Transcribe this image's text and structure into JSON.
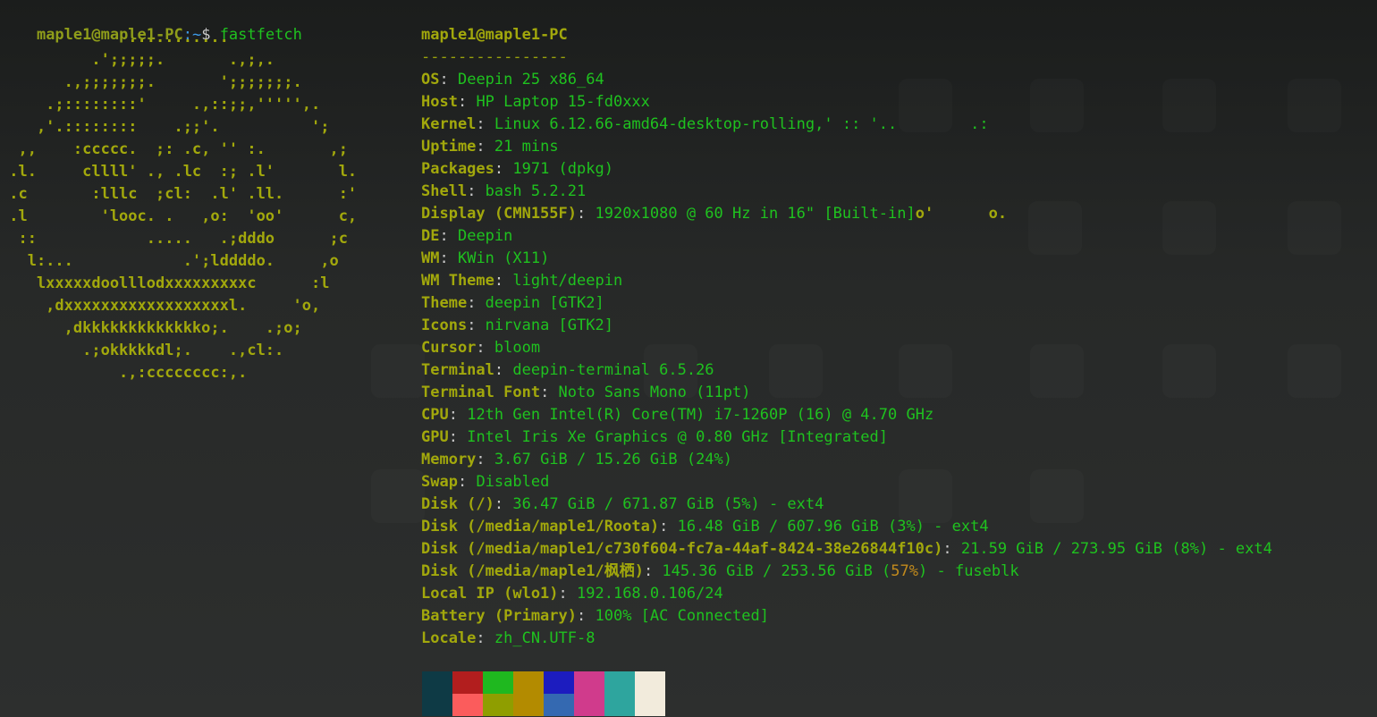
{
  "prompt": {
    "user_host": "maple1@maple1-PC",
    "path": ":~",
    "symbol": "$",
    "command": " fastfetch"
  },
  "logo_lines": [
    "              ...........",
    "          .';;;;;.       .,;,.",
    "       .,;;;;;;;.       ';;;;;;;.",
    "     .;::::::::'     .,::;;,''''',.",
    "    ,'.::::::::    .;;'.          ';",
    "  ,,    :ccccc.  ;: .c, '' :.       ,;",
    " .l.     cllll' ., .lc  :; .l'       l.",
    " .c       :lllc  ;cl:  .l' .ll.      :'",
    " .l        'looc. .   ,o:  'oo'      c,",
    "  ::            .....   .;dddo      ;c",
    "   l:...            .';lddddo.     ,o",
    "    lxxxxxdoolllodxxxxxxxxxc      :l",
    "     ,dxxxxxxxxxxxxxxxxxxl.     'o,",
    "       ,dkkkkkkkkkkkkko;.    .;o;",
    "         .;okkkkkdl;.    .,cl:.",
    "             .,:cccccccc:,."
  ],
  "info": {
    "title": "maple1@maple1-PC",
    "separator": "----------------",
    "rows": [
      {
        "key": "OS",
        "value": "Deepin 25 x86_64"
      },
      {
        "key": "Host",
        "value": "HP Laptop 15-fd0xxx"
      },
      {
        "key": "Kernel",
        "value": "Linux 6.12.66-amd64-desktop-rolling,' :: '..        .:"
      },
      {
        "key": "Uptime",
        "value": "21 mins"
      },
      {
        "key": "Packages",
        "value": "1971 (dpkg)"
      },
      {
        "key": "Shell",
        "value": "bash 5.2.21"
      },
      {
        "key": "Display (CMN155F)",
        "value": "1920x1080 @ 60 Hz in 16\" [Built-in]",
        "tail": "o'      o."
      },
      {
        "key": "DE",
        "value": "Deepin"
      },
      {
        "key": "WM",
        "value": "KWin (X11)"
      },
      {
        "key": "WM Theme",
        "value": "light/deepin"
      },
      {
        "key": "Theme",
        "value": "deepin [GTK2]"
      },
      {
        "key": "Icons",
        "value": "nirvana [GTK2]"
      },
      {
        "key": "Cursor",
        "value": "bloom"
      },
      {
        "key": "Terminal",
        "value": "deepin-terminal 6.5.26"
      },
      {
        "key": "Terminal Font",
        "value": "Noto Sans Mono (11pt)"
      },
      {
        "key": "CPU",
        "value": "12th Gen Intel(R) Core(TM) i7-1260P (16) @ 4.70 GHz"
      },
      {
        "key": "GPU",
        "value": "Intel Iris Xe Graphics @ 0.80 GHz [Integrated]"
      },
      {
        "key": "Memory",
        "value": "3.67 GiB / 15.26 GiB (24%)"
      },
      {
        "key": "Swap",
        "value": "Disabled"
      },
      {
        "key": "Disk (/)",
        "value": "36.47 GiB / 671.87 GiB (5%) - ext4"
      },
      {
        "key": "Disk (/media/maple1/Roota)",
        "value": "16.48 GiB / 607.96 GiB (3%) - ext4"
      },
      {
        "key": "Disk (/media/maple1/c730f604-fc7a-44af-8424-38e26844f10c)",
        "value": "21.59 GiB / 273.95 GiB (8%) - ext4"
      },
      {
        "key": "Disk (/media/maple1/枫栖)",
        "value_pre": "145.36 GiB / 253.56 GiB (",
        "value_warn": "57%",
        "value_post": ") - fuseblk"
      },
      {
        "key": "Local IP (wlo1)",
        "value": "192.168.0.106/24"
      },
      {
        "key": "Battery (Primary)",
        "value": "100% [AC Connected]"
      },
      {
        "key": "Locale",
        "value": "zh_CN.UTF-8"
      }
    ]
  },
  "palette": {
    "top": [
      "#0e3a45",
      "#b21e1e",
      "#1fb81f",
      "#b38b00",
      "#1c1cbf",
      "#d03b8c",
      "#2ea59e",
      "#f2ebdc"
    ],
    "bottom": [
      "#0e3a45",
      "#fb5c5c",
      "#8f9e00",
      "#b38b00",
      "#3469b1",
      "#d03b8c",
      "#2ea59e",
      "#f2ebdc"
    ]
  }
}
